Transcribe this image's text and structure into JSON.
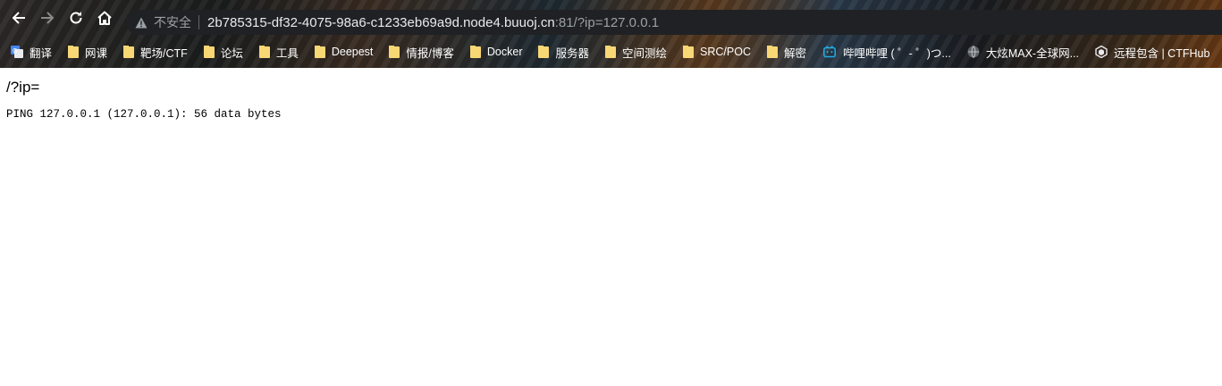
{
  "browser": {
    "security_label": "不安全",
    "url_main": "2b785315-df32-4075-98a6-c1233eb69a9d.node4.buuoj.cn",
    "url_rest": ":81/?ip=127.0.0.1",
    "bookmarks": [
      {
        "label": "翻译",
        "icon": "google-translate-icon"
      },
      {
        "label": "网课",
        "icon": "folder-icon"
      },
      {
        "label": "靶场/CTF",
        "icon": "folder-icon"
      },
      {
        "label": "论坛",
        "icon": "folder-icon"
      },
      {
        "label": "工具",
        "icon": "folder-icon"
      },
      {
        "label": "Deepest",
        "icon": "folder-icon"
      },
      {
        "label": "情报/博客",
        "icon": "folder-icon"
      },
      {
        "label": "Docker",
        "icon": "folder-icon"
      },
      {
        "label": "服务器",
        "icon": "folder-icon"
      },
      {
        "label": "空间测绘",
        "icon": "folder-icon"
      },
      {
        "label": "SRC/POC",
        "icon": "folder-icon"
      },
      {
        "label": "解密",
        "icon": "folder-icon"
      },
      {
        "label": "哔哩哔哩 ( ゜- ゜)つ...",
        "icon": "bilibili-icon"
      },
      {
        "label": "大炫MAX-全球网...",
        "icon": "globe-icon"
      },
      {
        "label": "远程包含 | CTFHub",
        "icon": "ctfhub-icon"
      }
    ]
  },
  "page": {
    "param_text": "/?ip=",
    "output": "PING 127.0.0.1 (127.0.0.1): 56 data bytes"
  }
}
